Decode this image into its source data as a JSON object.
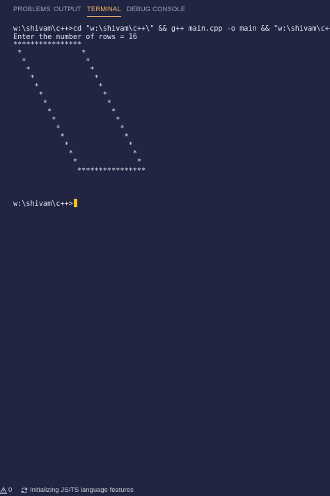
{
  "panel": {
    "tabs": [
      {
        "label": "PROBLEMS"
      },
      {
        "label": "OUTPUT"
      },
      {
        "label": "TERMINAL"
      },
      {
        "label": "DEBUG CONSOLE"
      }
    ],
    "active_tab": "TERMINAL"
  },
  "terminal": {
    "lines": [
      "w:\\shivam\\c++>cd \"w:\\shivam\\c++\\\" && g++ main.cpp -o main && \"w:\\shivam\\c++\\",
      "Enter the number of rows = 16",
      "****************",
      " *              *",
      "  *              *",
      "   *              *",
      "    *              *",
      "     *              *",
      "      *              *",
      "       *              *",
      "        *              *",
      "         *              *",
      "          *              *",
      "           *              *",
      "            *              *",
      "             *              *",
      "              *              *",
      "               ****************"
    ],
    "prompt": "w:\\shivam\\c++>"
  },
  "statusbar": {
    "problems_count": "0",
    "message": "Initializing JS/TS language features"
  },
  "colors": {
    "background": "#222542",
    "active_tab": "#e9b266",
    "cursor": "#f5c118"
  }
}
